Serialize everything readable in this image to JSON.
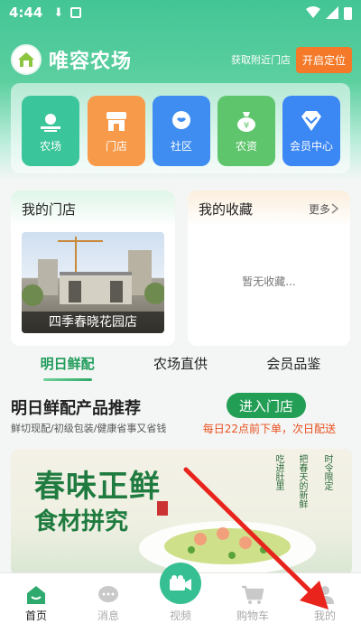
{
  "status_bar": {
    "time": "4:44"
  },
  "brand": {
    "name": "唯容农场",
    "nearby_text": "获取附近门店",
    "locate_label": "开启定位"
  },
  "nav": [
    {
      "label": "农场",
      "icon": "farm-sun-icon",
      "color": "#3bc59a"
    },
    {
      "label": "门店",
      "icon": "store-icon",
      "color": "#f79a4a"
    },
    {
      "label": "社区",
      "icon": "community-chat-icon",
      "color": "#3f8df0"
    },
    {
      "label": "农资",
      "icon": "money-bag-icon",
      "color": "#5fc56c"
    },
    {
      "label": "会员中心",
      "icon": "diamond-icon",
      "color": "#3b87f3"
    }
  ],
  "my_store": {
    "title": "我的门店",
    "store_name": "四季春晓花园店"
  },
  "favorites": {
    "title": "我的收藏",
    "more_label": "更多",
    "empty_text": "暂无收藏..."
  },
  "tabs": [
    {
      "label": "明日鲜配",
      "active": true
    },
    {
      "label": "农场直供",
      "active": false
    },
    {
      "label": "会员品鉴",
      "active": false
    }
  ],
  "section": {
    "title": "明日鲜配产品推荐",
    "subtitle": "鲜切现配/初级包装/健康省事又省钱",
    "enter_label": "进入门店",
    "delivery_note": "每日22点前下单，次日配送"
  },
  "banner": {
    "title": "春味正鲜",
    "subtitle": "食材拼究",
    "vertical_1": "时令限定",
    "vertical_2": "把春天的新鲜",
    "vertical_3": "吃进肚里"
  },
  "bottom_nav": [
    {
      "label": "首页",
      "icon": "home-icon",
      "active": true
    },
    {
      "label": "消息",
      "icon": "message-icon",
      "active": false
    },
    {
      "label": "视频",
      "icon": "video-camera-icon",
      "active": false
    },
    {
      "label": "购物车",
      "icon": "cart-icon",
      "active": false
    },
    {
      "label": "我的",
      "icon": "profile-icon",
      "active": false
    }
  ],
  "colors": {
    "accent_green": "#229e55",
    "orange": "#f47a2a",
    "arrow_red": "#e8241c"
  }
}
